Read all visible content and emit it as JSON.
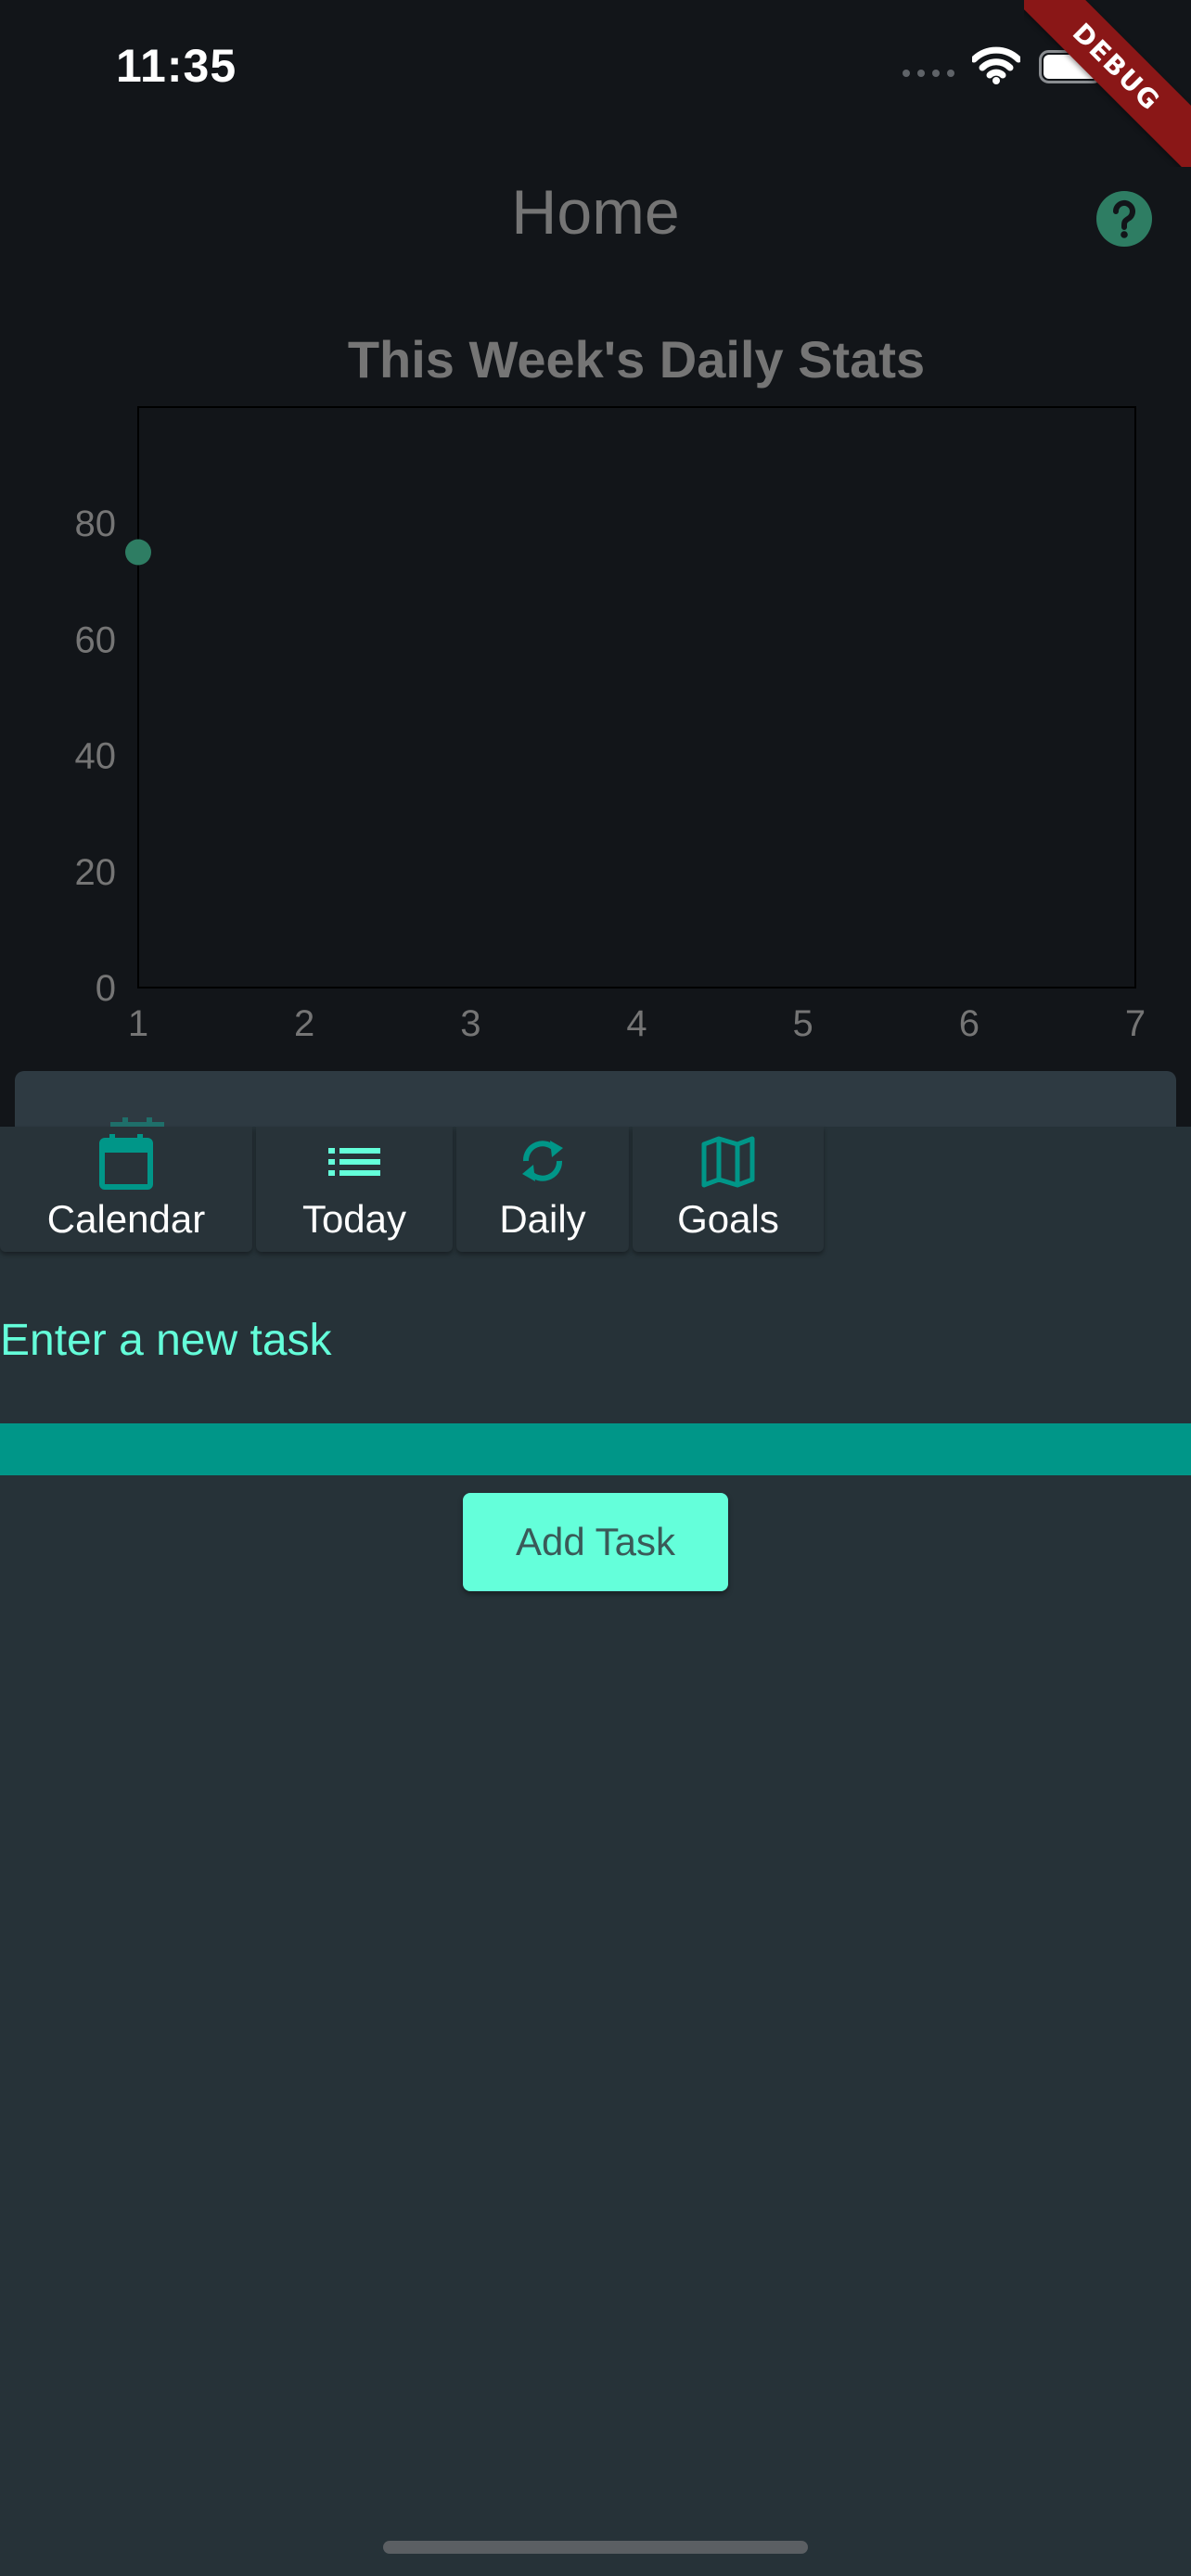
{
  "status_bar": {
    "time": "11:35",
    "icons": [
      "signal-dots-icon",
      "wifi-icon",
      "battery-icon"
    ]
  },
  "debug_banner": "DEBUG",
  "app_bar": {
    "title": "Home",
    "help_icon": "help-circle-icon"
  },
  "chart_data": {
    "type": "line",
    "title": "This Week's Daily Stats",
    "x": [
      1
    ],
    "series": [
      {
        "values": [
          75
        ]
      }
    ],
    "x_ticks": [
      "1",
      "2",
      "3",
      "4",
      "5",
      "6",
      "7"
    ],
    "y_ticks": [
      "0",
      "20",
      "40",
      "60",
      "80"
    ],
    "xlim": [
      1,
      7
    ],
    "ylim": [
      0,
      100
    ],
    "xlabel": "",
    "ylabel": "",
    "grid": false,
    "point_color": "#2e7d63"
  },
  "tabs": [
    {
      "label": "Calendar",
      "icon": "calendar-icon"
    },
    {
      "label": "Today",
      "icon": "list-icon"
    },
    {
      "label": "Daily",
      "icon": "refresh-icon"
    },
    {
      "label": "Goals",
      "icon": "map-icon"
    }
  ],
  "task_form": {
    "placeholder": "Enter a new task",
    "value": "",
    "button_label": "Add Task"
  },
  "colors": {
    "accent": "#64ffda",
    "teal": "#009688",
    "sheet_background": "#263238",
    "page_background": "#121519"
  }
}
